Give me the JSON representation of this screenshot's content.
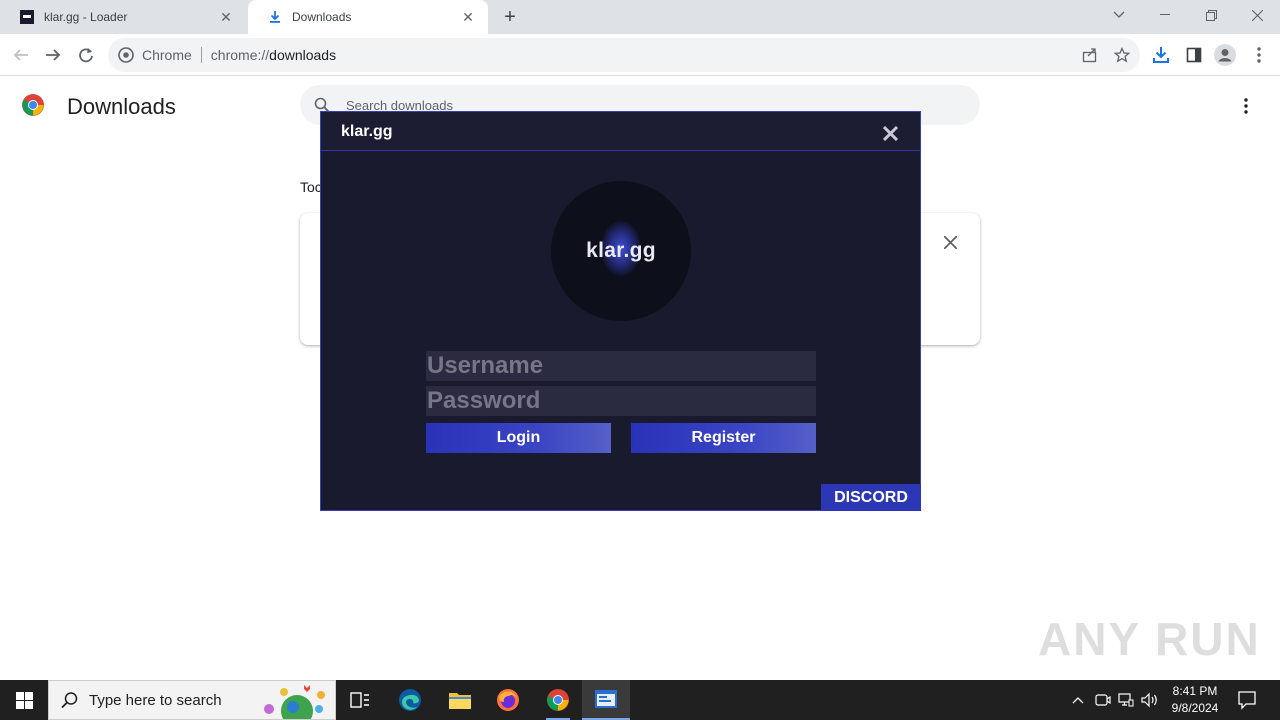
{
  "browser": {
    "tabs": [
      {
        "title": "klar.gg - Loader",
        "favicon": "klar-favicon-icon"
      },
      {
        "title": "Downloads",
        "favicon": "download-icon"
      }
    ],
    "omnibox": {
      "chip": "Chrome",
      "url_scheme": "chrome://",
      "url_path": "downloads"
    }
  },
  "downloads_page": {
    "title": "Downloads",
    "search_placeholder": "Search downloads",
    "date_header": "Toc"
  },
  "loader": {
    "title": "klar.gg",
    "logo_text": "klar.gg",
    "username_placeholder": "Username",
    "password_placeholder": "Password",
    "login_label": "Login",
    "register_label": "Register",
    "discord_label": "DISCORD",
    "accent_color": "#2c37b5",
    "background_color": "#1a1a2e"
  },
  "watermark": "ANY RUN",
  "taskbar": {
    "search_placeholder": "Type here to search",
    "time": "8:41 PM",
    "date": "9/8/2024"
  }
}
